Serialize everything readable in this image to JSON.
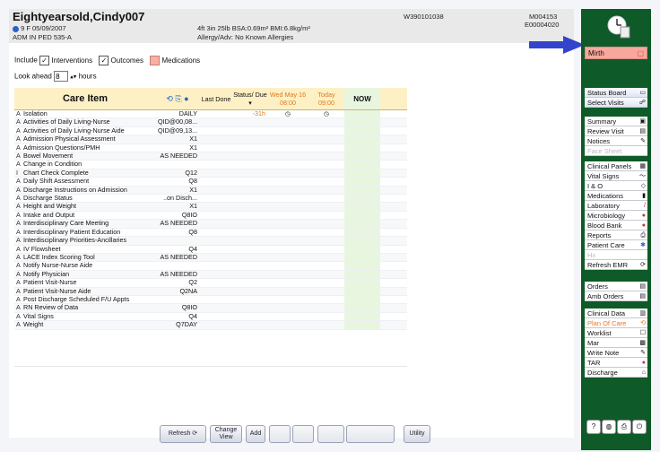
{
  "header": {
    "patient_name": "Eightyearsold,Cindy007",
    "age_sex_dob": "9  F  05/09/2007",
    "admit_line": "ADM IN  PED  535-A",
    "vitals": "4ft 3in  25lb  BSA:0.69m²  BMI:6.8kg/m²",
    "allergy": "Allergy/Adv: No Known Allergies",
    "id_center": "W390101038",
    "id_right_1": "M004153",
    "id_right_2": "E00004020"
  },
  "filters": {
    "include_label": "Include",
    "interventions_label": "Interventions",
    "outcomes_label": "Outcomes",
    "medications_label": "Medications",
    "look_ahead_label": "Look ahead",
    "look_ahead_value": "8",
    "hours_label": "hours"
  },
  "grid": {
    "columns": {
      "care_item": "Care Item",
      "last_done": "Last Done",
      "status_due": "Status/ Due",
      "wed_date": "Wed May 16",
      "wed_time": "08:00",
      "today": "Today",
      "today_time": "09:00",
      "now": "NOW"
    },
    "rows": [
      {
        "s": "A",
        "name": "Isolation",
        "freq": "DAILY",
        "due": "-31h"
      },
      {
        "s": "A",
        "name": "Activities of Daily Living-Nurse",
        "freq": "QID@00,08...",
        "due": ""
      },
      {
        "s": "A",
        "name": "Activities of Daily Living-Nurse Aide",
        "freq": "QID@09,13...",
        "due": ""
      },
      {
        "s": "A",
        "name": "Admission Physical Assessment",
        "freq": "X1",
        "due": ""
      },
      {
        "s": "A",
        "name": "Admission Questions/PMH",
        "freq": "X1",
        "due": ""
      },
      {
        "s": "A",
        "name": "Bowel Movement",
        "freq": "AS NEEDED",
        "due": ""
      },
      {
        "s": "A",
        "name": "Change in Condition",
        "freq": "",
        "due": ""
      },
      {
        "s": "I",
        "name": "Chart Check Complete",
        "freq": "Q12",
        "due": ""
      },
      {
        "s": "A",
        "name": "Daily Shift Assessment",
        "freq": "Q8",
        "due": ""
      },
      {
        "s": "A",
        "name": "Discharge Instructions on Admission",
        "freq": "X1",
        "due": ""
      },
      {
        "s": "A",
        "name": "Discharge Status",
        "freq": "..on Disch...",
        "due": ""
      },
      {
        "s": "A",
        "name": "Height and Weight",
        "freq": "X1",
        "due": ""
      },
      {
        "s": "A",
        "name": "Intake and Output",
        "freq": "Q8IO",
        "due": ""
      },
      {
        "s": "A",
        "name": "Interdisciplinary Care Meeting",
        "freq": "AS NEEDED",
        "due": ""
      },
      {
        "s": "A",
        "name": "Interdisciplinary Patient Education",
        "freq": "Q8",
        "due": ""
      },
      {
        "s": "A",
        "name": "Interdisciplinary Priorities-Ancillaries",
        "freq": "",
        "due": ""
      },
      {
        "s": "A",
        "name": "IV Flowsheet",
        "freq": "Q4",
        "due": ""
      },
      {
        "s": "A",
        "name": "LACE Index Scoring Tool",
        "freq": "AS NEEDED",
        "due": ""
      },
      {
        "s": "A",
        "name": "Notify Nurse-Nurse Aide",
        "freq": "",
        "due": ""
      },
      {
        "s": "A",
        "name": "Notify Physician",
        "freq": "AS NEEDED",
        "due": ""
      },
      {
        "s": "A",
        "name": "Patient Visit-Nurse",
        "freq": "Q2",
        "due": ""
      },
      {
        "s": "A",
        "name": "Patient Visit-Nurse Aide",
        "freq": "Q2NA",
        "due": ""
      },
      {
        "s": "A",
        "name": "Post Discharge Scheduled F/U Appts",
        "freq": "",
        "due": ""
      },
      {
        "s": "A",
        "name": "RN Review of Data",
        "freq": "Q8IO",
        "due": ""
      },
      {
        "s": "A",
        "name": "Vital Signs",
        "freq": "Q4",
        "due": ""
      },
      {
        "s": "A",
        "name": "Weight",
        "freq": "Q7DAY",
        "due": ""
      }
    ]
  },
  "bottom": {
    "refresh": "Refresh",
    "change_view": "Change View",
    "add": "Add",
    "utility": "Utility"
  },
  "sidebar": {
    "mirth": "Mirth",
    "group1": [
      "Status Board",
      "Select Visits"
    ],
    "group2": [
      "Summary",
      "Review Visit",
      "Notices",
      "Face Sheet"
    ],
    "group3": [
      "Clinical Panels",
      "Vital Signs",
      "I & O",
      "Medications",
      "Laboratory",
      "Microbiology",
      "Blood Bank",
      "Reports",
      "Patient Care",
      "Hx",
      "Refresh EMR"
    ],
    "group4": [
      "Orders",
      "Amb Orders"
    ],
    "group5": [
      "Clinical Data",
      "Plan Of Care",
      "Worklist",
      "Mar",
      "Write Note",
      "TAR",
      "Discharge"
    ],
    "help": "?"
  },
  "colors": {
    "sidebar_bg": "#0e5a28",
    "mirth_bg": "#f7a89c",
    "arrow": "#3344cc",
    "grid_header": "#fdf0c5",
    "today_orange": "#e07a1a",
    "now_col": "#e8f6e0"
  }
}
